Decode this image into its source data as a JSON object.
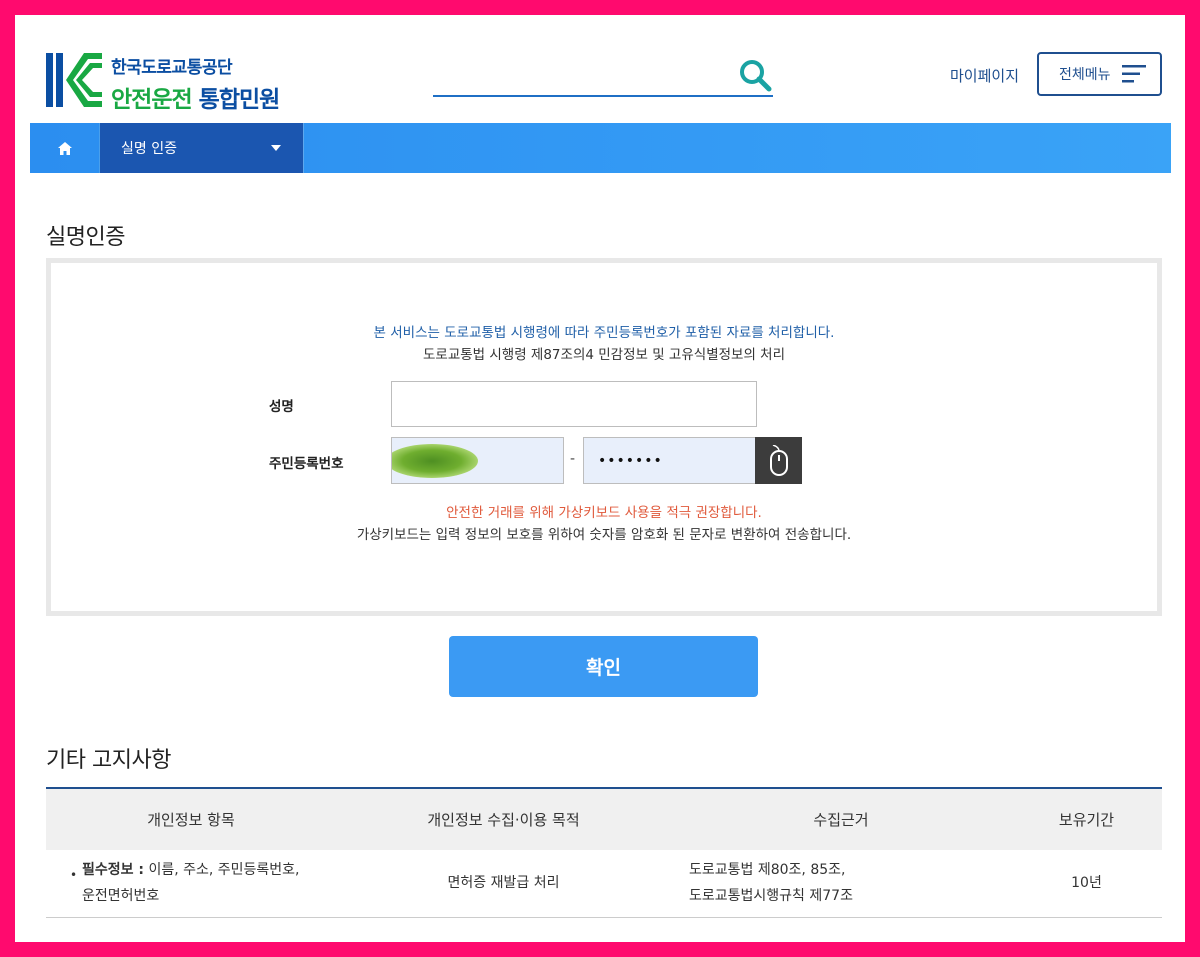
{
  "colors": {
    "frame": "#ff0a6e",
    "brand_blue": "#0b4ea2",
    "brand_green": "#19a843",
    "nav_blue": "#2b8ef0",
    "crumb_blue": "#1b56b0",
    "confirm_blue": "#3b9af3",
    "warning": "#e05a3c"
  },
  "header": {
    "org_name": "한국도로교통공단",
    "service_name_green": "안전운전",
    "service_name_blue": "통합민원",
    "search_placeholder": "",
    "mypage_label": "마이페이지",
    "allmenu_label": "전체메뉴"
  },
  "nav": {
    "home_icon": "home-icon",
    "breadcrumb_label": "실명 인증"
  },
  "auth": {
    "title": "실명인증",
    "notice_line1": "본 서비스는 도로교통법 시행령에 따라 주민등록번호가 포함된 자료를 처리합니다.",
    "notice_line2": "도로교통법 시행령 제87조의4 민감정보 및 고유식별정보의 처리",
    "name_label": "성명",
    "name_value": "",
    "rrn_label": "주민등록번호",
    "rrn_separator": "-",
    "rrn_back_masked": "•••••••",
    "vk_warning": "안전한 거래를 위해 가상키보드 사용을 적극 권장합니다.",
    "vk_description": "가상키보드는 입력 정보의 보호를 위하여 숫자를 암호화 된 문자로 변환하여 전송합니다."
  },
  "confirm_label": "확인",
  "notices": {
    "title": "기타 고지사항",
    "columns": [
      "개인정보 항목",
      "개인정보 수집·이용 목적",
      "수집근거",
      "보유기간"
    ],
    "rows": [
      {
        "item_prefix": "필수정보 :",
        "item_line1": " 이름, 주소, 주민등록번호,",
        "item_line2": "운전면허번호",
        "purpose": "면허증 재발급 처리",
        "basis_line1": "도로교통법 제80조, 85조,",
        "basis_line2": "도로교통법시행규칙 제77조",
        "retention": "10년"
      }
    ]
  }
}
